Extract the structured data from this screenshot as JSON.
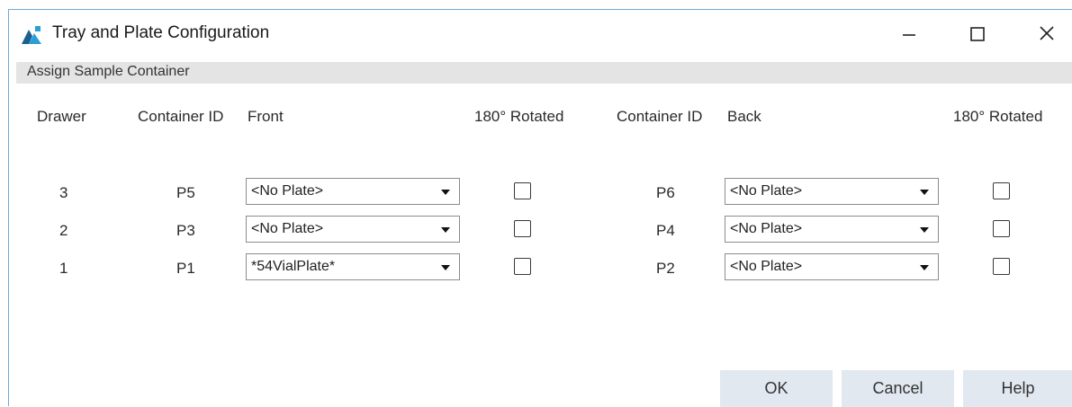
{
  "window": {
    "title": "Tray and Plate Configuration"
  },
  "section": {
    "label": "Assign Sample Container"
  },
  "columns": {
    "drawer": "Drawer",
    "front_container_id": "Container ID",
    "front": "Front",
    "front_rotated": "180° Rotated",
    "back_container_id": "Container ID",
    "back": "Back",
    "back_rotated": "180° Rotated"
  },
  "rows": [
    {
      "drawer": "3",
      "front_id": "P5",
      "front_plate": "<No Plate>",
      "front_rotated": false,
      "back_id": "P6",
      "back_plate": "<No Plate>",
      "back_rotated": false
    },
    {
      "drawer": "2",
      "front_id": "P3",
      "front_plate": "<No Plate>",
      "front_rotated": false,
      "back_id": "P4",
      "back_plate": "<No Plate>",
      "back_rotated": false
    },
    {
      "drawer": "1",
      "front_id": "P1",
      "front_plate": "*54VialPlate*",
      "front_rotated": false,
      "back_id": "P2",
      "back_plate": "<No Plate>",
      "back_rotated": false
    }
  ],
  "buttons": {
    "ok": "OK",
    "cancel": "Cancel",
    "help": "Help"
  },
  "colors": {
    "accent": "#0078d7",
    "button_bg": "#e1e8f0",
    "header_bg": "#e4e4e4"
  }
}
